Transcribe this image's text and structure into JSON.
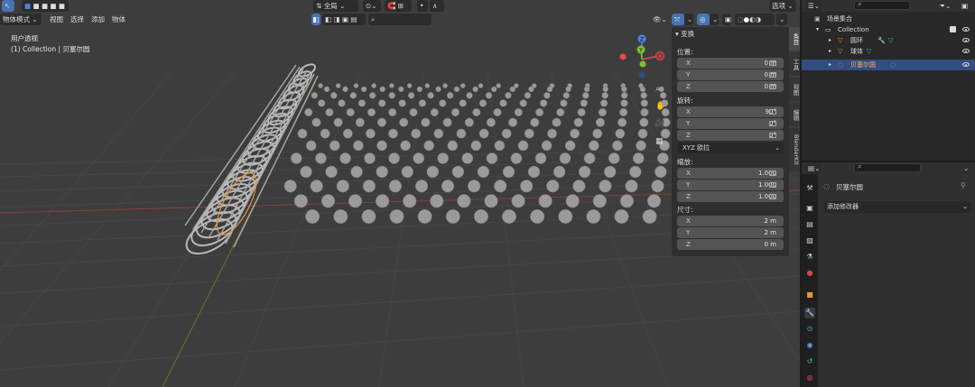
{
  "viewport": {
    "mode_label": "物体模式",
    "menus": [
      "视图",
      "选择",
      "添加",
      "物体"
    ],
    "orientation_label": "全局",
    "options_label": "选项",
    "view_name": "用户透视",
    "collection_info": "(1) Collection | 贝塞尔圆",
    "gizmo": {
      "z": "Z",
      "y": "Y",
      "x": "X"
    }
  },
  "npanel": {
    "header": "变换",
    "location_label": "位置:",
    "location": [
      {
        "axis": "X",
        "value": "0 m"
      },
      {
        "axis": "Y",
        "value": "0 m"
      },
      {
        "axis": "Z",
        "value": "0 m"
      }
    ],
    "rotation_label": "旋转:",
    "rotation": [
      {
        "axis": "X",
        "value": "90°"
      },
      {
        "axis": "Y",
        "value": "0°"
      },
      {
        "axis": "Z",
        "value": "0°"
      }
    ],
    "rotation_mode": "XYZ 欧拉",
    "scale_label": "缩放:",
    "scale": [
      {
        "axis": "X",
        "value": "1.000"
      },
      {
        "axis": "Y",
        "value": "1.000"
      },
      {
        "axis": "Z",
        "value": "1.000"
      }
    ],
    "dimensions_label": "尺寸:",
    "dimensions": [
      {
        "axis": "X",
        "value": "2 m"
      },
      {
        "axis": "Y",
        "value": "2 m"
      },
      {
        "axis": "Z",
        "value": "0 m"
      }
    ],
    "tabs": [
      "条目",
      "工具",
      "视图",
      "编辑",
      "BlenderKit"
    ]
  },
  "outliner": {
    "scene_collection": "场景集合",
    "collection": "Collection",
    "items": [
      "圆环",
      "球体",
      "贝塞尔圆"
    ]
  },
  "properties": {
    "object_name": "贝塞尔圆",
    "add_modifier": "添加修改器"
  },
  "colors": {
    "accent": "#4772b3",
    "x_axis": "#e8474f",
    "y_axis": "#7fbf2f",
    "z_axis": "#4a88e0",
    "object_orange": "#e8943a",
    "selected_row": "#334d80"
  }
}
